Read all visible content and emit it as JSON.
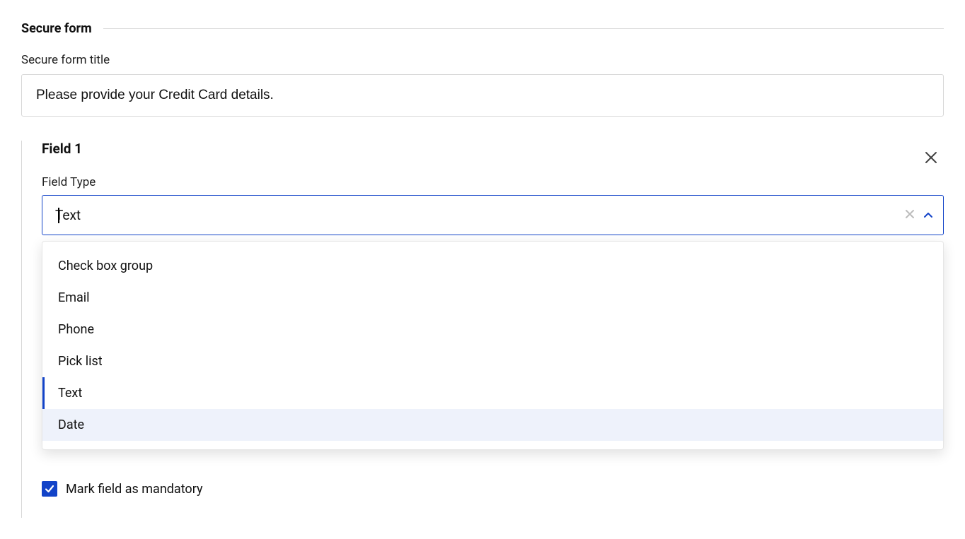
{
  "section": {
    "title": "Secure form"
  },
  "formTitle": {
    "label": "Secure form title",
    "value": "Please provide your Credit Card details."
  },
  "field": {
    "title": "Field 1",
    "fieldTypeLabel": "Field Type",
    "selectedValue": "Text",
    "options": {
      "0": {
        "label": "Check box group"
      },
      "1": {
        "label": "Email"
      },
      "2": {
        "label": "Phone"
      },
      "3": {
        "label": "Pick list"
      },
      "4": {
        "label": "Text"
      },
      "5": {
        "label": "Date"
      }
    },
    "mandatoryLabel": "Mark field as mandatory",
    "mandatoryChecked": true
  }
}
